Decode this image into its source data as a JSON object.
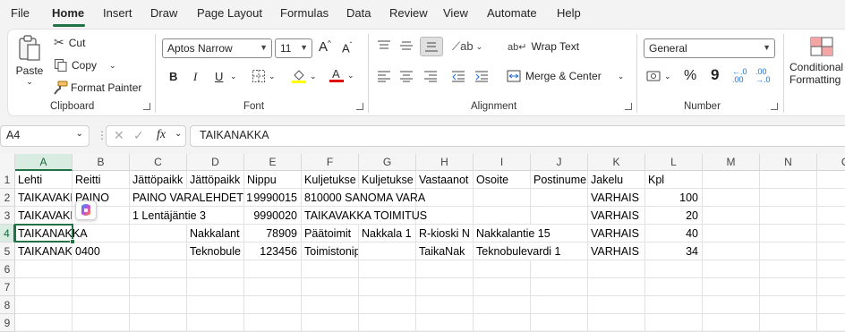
{
  "menu": {
    "tabs": [
      "File",
      "Home",
      "Insert",
      "Draw",
      "Page Layout",
      "Formulas",
      "Data",
      "Review",
      "View",
      "Automate",
      "Help"
    ],
    "active": "Home"
  },
  "ribbon": {
    "clipboard": {
      "paste": "Paste",
      "cut": "Cut",
      "copy": "Copy",
      "format_painter": "Format Painter",
      "label": "Clipboard"
    },
    "font": {
      "name": "Aptos Narrow",
      "size": "11",
      "bold": "B",
      "italic": "I",
      "underline": "U",
      "label": "Font",
      "highlight_color": "#ffff00",
      "font_color": "#e00000"
    },
    "alignment": {
      "wrap_text": "Wrap Text",
      "merge_center": "Merge & Center",
      "label": "Alignment"
    },
    "number": {
      "format": "General",
      "label": "Number",
      "percent": "%",
      "comma": "9"
    },
    "styles": {
      "conditional": "Conditional",
      "formatting": "Formatting"
    }
  },
  "formula_bar": {
    "name_box": "A4",
    "fx": "fx",
    "content": "TAIKANAKKA"
  },
  "sheet": {
    "columns": [
      "A",
      "B",
      "C",
      "D",
      "E",
      "F",
      "G",
      "H",
      "I",
      "J",
      "K",
      "L",
      "M",
      "N",
      "O"
    ],
    "row_numbers": [
      "1",
      "2",
      "3",
      "4",
      "5",
      "6",
      "7",
      "8",
      "9"
    ],
    "selected_cell": "A4",
    "rows": [
      [
        "Lehti",
        "Reitti",
        "Jättöpaikk",
        "Jättöpaikk",
        "Nippu",
        "Kuljetukse",
        "Kuljetukse",
        "Vastaanot",
        "Osoite",
        "Postinume",
        "Jakelu",
        "Kpl"
      ],
      [
        "TAIKAVAKK",
        "PAINO",
        "PAINO VARALEHDET 1",
        "",
        "9990015",
        "810000 SANOMA VARA",
        "",
        "",
        "",
        "",
        "VARHAIS",
        "100"
      ],
      [
        "TAIKAVAKK",
        "",
        "1 Lentäjäntie 3",
        "",
        "9990020",
        "TAIKAVAKKA TOIMITUS",
        "",
        "",
        "",
        "",
        "VARHAIS",
        "20"
      ],
      [
        "TAIKANAKKA",
        "",
        "",
        "Nakkalant",
        "78909",
        "Päätoimit",
        "Nakkala 1",
        "R-kioski N",
        "Nakkalantie 15",
        "",
        "VARHAIS",
        "40"
      ],
      [
        "TAIKANAK",
        "0400",
        "",
        "Teknobule",
        "123456",
        "Toimistonippu",
        "",
        "TaikaNak",
        "Teknobulevardi 1",
        "",
        "VARHAIS",
        "34"
      ]
    ]
  }
}
